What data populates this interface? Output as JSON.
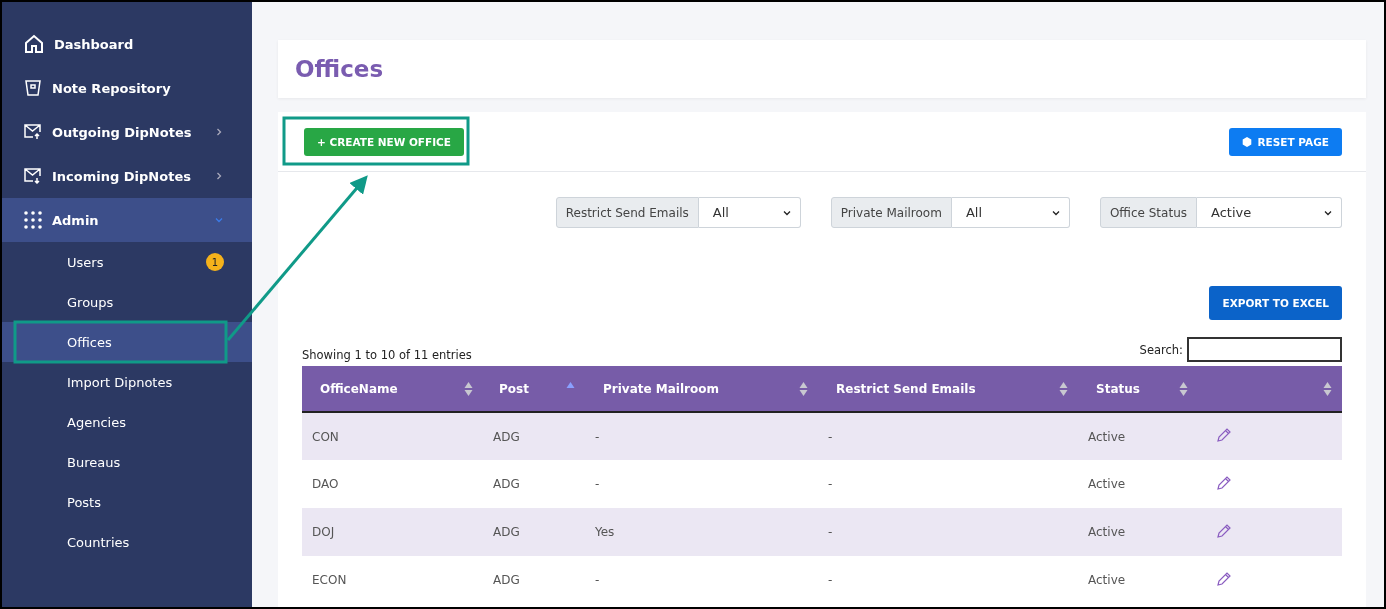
{
  "sidebar": {
    "items": [
      {
        "label": "Dashboard",
        "selected": false
      },
      {
        "label": "Note Repository",
        "selected": false
      },
      {
        "label": "Outgoing DipNotes",
        "selected": false,
        "expanded": false
      },
      {
        "label": "Incoming DipNotes",
        "selected": false,
        "expanded": false
      },
      {
        "label": "Admin",
        "selected": true,
        "expanded": true,
        "children": [
          {
            "label": "Users",
            "badge": "1",
            "selected": false
          },
          {
            "label": "Groups",
            "selected": false
          },
          {
            "label": "Offices",
            "selected": true
          },
          {
            "label": "Import Dipnotes",
            "selected": false
          },
          {
            "label": "Agencies",
            "selected": false
          },
          {
            "label": "Bureaus",
            "selected": false
          },
          {
            "label": "Posts",
            "selected": false
          },
          {
            "label": "Countries",
            "selected": false
          }
        ]
      }
    ]
  },
  "page": {
    "title": "Offices"
  },
  "toolbar": {
    "create_button": "+ CREATE NEW OFFICE",
    "reset_button": "RESET PAGE"
  },
  "filters": [
    {
      "label": "Restrict Send Emails",
      "value": "All"
    },
    {
      "label": "Private Mailroom",
      "value": "All"
    },
    {
      "label": "Office Status",
      "value": "Active"
    }
  ],
  "export_button": "EXPORT TO EXCEL",
  "table": {
    "info": "Showing 1 to 10 of 11 entries",
    "search_label": "Search:",
    "columns": [
      {
        "label": "OfficeName",
        "sorted": false
      },
      {
        "label": "Post",
        "sorted": true
      },
      {
        "label": "Private Mailroom",
        "sorted": false
      },
      {
        "label": "Restrict Send Emails",
        "sorted": false
      },
      {
        "label": "Status",
        "sorted": false
      },
      {
        "sorted": false
      }
    ],
    "rows": [
      {
        "cells": [
          "CON",
          "ADG",
          "-",
          "-",
          "Active"
        ]
      },
      {
        "cells": [
          "DAO",
          "ADG",
          "-",
          "-",
          "Active"
        ]
      },
      {
        "cells": [
          "DOJ",
          "ADG",
          "Yes",
          "-",
          "Active"
        ]
      },
      {
        "cells": [
          "ECON",
          "ADG",
          "-",
          "-",
          "Active"
        ]
      }
    ]
  },
  "annotations": [
    {
      "kind": "frame"
    },
    {
      "kind": "frame"
    },
    {
      "kind": "arrow"
    }
  ]
}
